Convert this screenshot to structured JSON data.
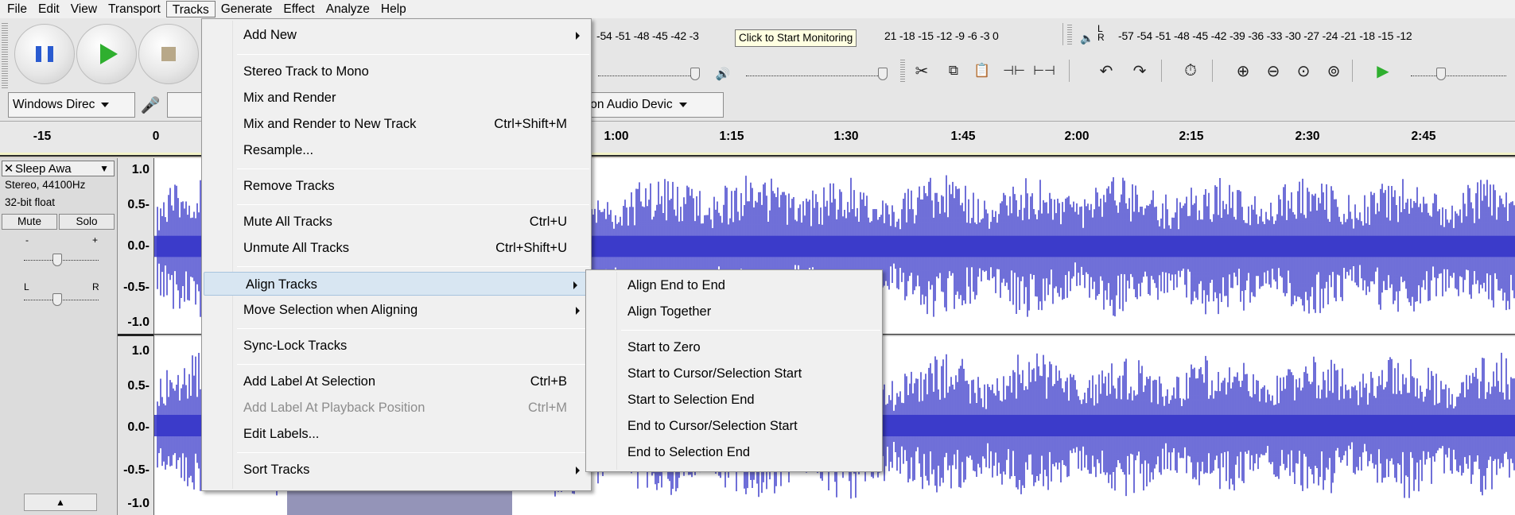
{
  "menubar": {
    "items": [
      "File",
      "Edit",
      "View",
      "Transport",
      "Tracks",
      "Generate",
      "Effect",
      "Analyze",
      "Help"
    ]
  },
  "meter_record": {
    "scale": "-54 -51 -48 -45 -42 -3",
    "scale_tail": "21 -18 -15 -12  -9  -6  -3  0"
  },
  "meter_play": {
    "lr": "L R",
    "scale": "-57 -54 -51 -48 -45 -42 -39 -36 -33 -30 -27 -24 -21 -18 -15 -12"
  },
  "tooltip": "Click to Start Monitoring",
  "device": {
    "host": "Windows Direc",
    "playback_device_fragment": "ition Audio Devic"
  },
  "ruler": {
    "labels": [
      "-15",
      "0",
      "1:00",
      "1:15",
      "1:30",
      "1:45",
      "2:00",
      "2:15",
      "2:30",
      "2:45"
    ]
  },
  "track": {
    "name": "Sleep Awa",
    "info1": "Stereo, 44100Hz",
    "info2": "32-bit float",
    "mute": "Mute",
    "solo": "Solo",
    "gain_minus": "-",
    "gain_plus": "+",
    "pan_l": "L",
    "pan_r": "R",
    "collapse": "▲"
  },
  "vruler": {
    "ch1": [
      "1.0",
      "0.5-",
      "0.0-",
      "-0.5-",
      "-1.0"
    ],
    "ch2": [
      "1.0",
      "0.5-",
      "0.0-",
      "-0.5-",
      "-1.0"
    ]
  },
  "tracks_menu": {
    "items": [
      {
        "label": "Add New",
        "shortcut": "",
        "submenu": true
      },
      {
        "label": "Stereo Track to Mono",
        "shortcut": ""
      },
      {
        "label": "Mix and Render",
        "shortcut": ""
      },
      {
        "label": "Mix and Render to New Track",
        "shortcut": "Ctrl+Shift+M"
      },
      {
        "label": "Resample...",
        "shortcut": ""
      },
      {
        "label": "Remove Tracks",
        "shortcut": ""
      },
      {
        "label": "Mute All Tracks",
        "shortcut": "Ctrl+U"
      },
      {
        "label": "Unmute All Tracks",
        "shortcut": "Ctrl+Shift+U"
      },
      {
        "label": "Align Tracks",
        "shortcut": "",
        "submenu": true,
        "highlighted": true
      },
      {
        "label": "Move Selection when Aligning",
        "shortcut": "",
        "submenu": true
      },
      {
        "label": "Sync-Lock Tracks",
        "shortcut": ""
      },
      {
        "label": "Add Label At Selection",
        "shortcut": "Ctrl+B"
      },
      {
        "label": "Add Label At Playback Position",
        "shortcut": "Ctrl+M",
        "disabled": true
      },
      {
        "label": "Edit Labels...",
        "shortcut": ""
      },
      {
        "label": "Sort Tracks",
        "shortcut": "",
        "submenu": true
      }
    ]
  },
  "align_submenu": {
    "items": [
      "Align End to End",
      "Align Together",
      "Start to Zero",
      "Start to Cursor/Selection Start",
      "Start to Selection End",
      "End to Cursor/Selection Start",
      "End to Selection End"
    ]
  },
  "colors": {
    "waveform": "#3232c8",
    "selection": "#9494b8",
    "menu_highlight": "#d8e6f2"
  }
}
